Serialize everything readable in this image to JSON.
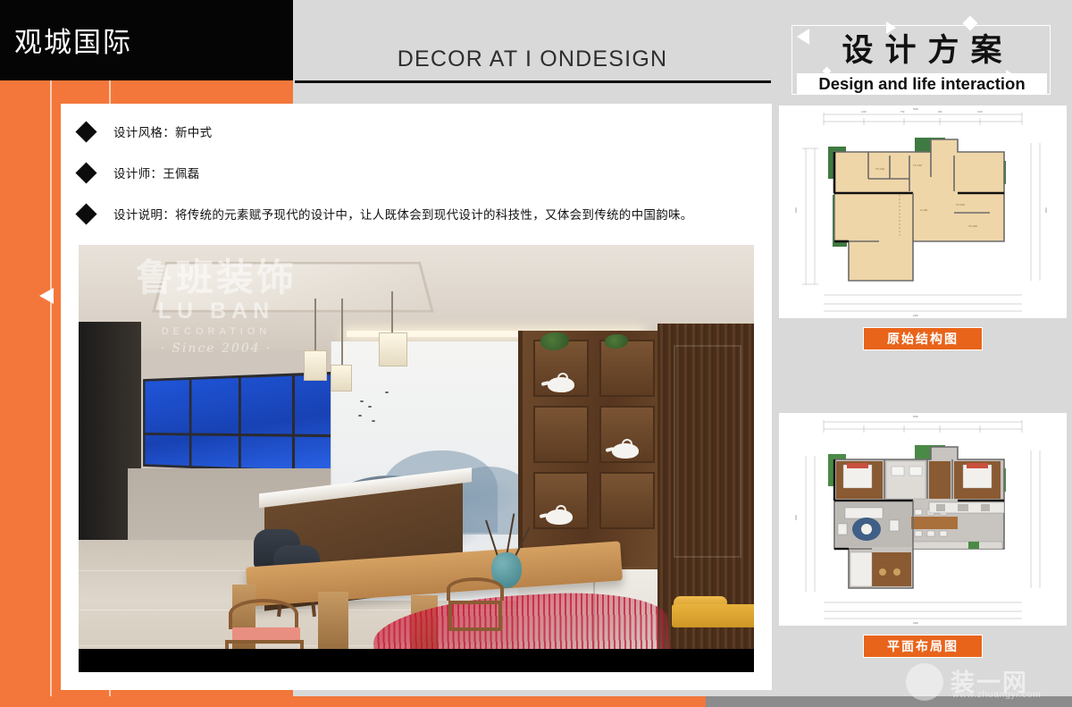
{
  "header": {
    "brand_cn": "观城国际",
    "center_title": "DECOR AT I ONDESIGN",
    "right_title_cn": "设计方案",
    "right_subtitle_en": "Design and life interaction"
  },
  "info_bullets": [
    {
      "label": "设计风格：新中式"
    },
    {
      "label": "设计师：王佩磊"
    },
    {
      "label": "设计说明：将传统的元素赋予现代的设计中，让人既体会到现代设计的科技性，又体会到传统的中国韵味。"
    }
  ],
  "photo": {
    "watermark_cn": "鲁班装饰",
    "watermark_en": "LU BAN",
    "watermark_sub": "DECORATION",
    "watermark_since": "· Since 2004 ·"
  },
  "plans": [
    {
      "id": "original-structure",
      "badge": "原始结构图"
    },
    {
      "id": "furniture-layout",
      "badge": "平面布局图"
    }
  ],
  "site_watermark": {
    "name_cn": "装一网",
    "url": "www.zhuangyi.com"
  },
  "colors": {
    "orange": "#f3773a",
    "badge_orange": "#e8641b",
    "black": "#050505",
    "page_gray": "#d9d9d9",
    "bottom_gray": "#8c8c8c"
  }
}
